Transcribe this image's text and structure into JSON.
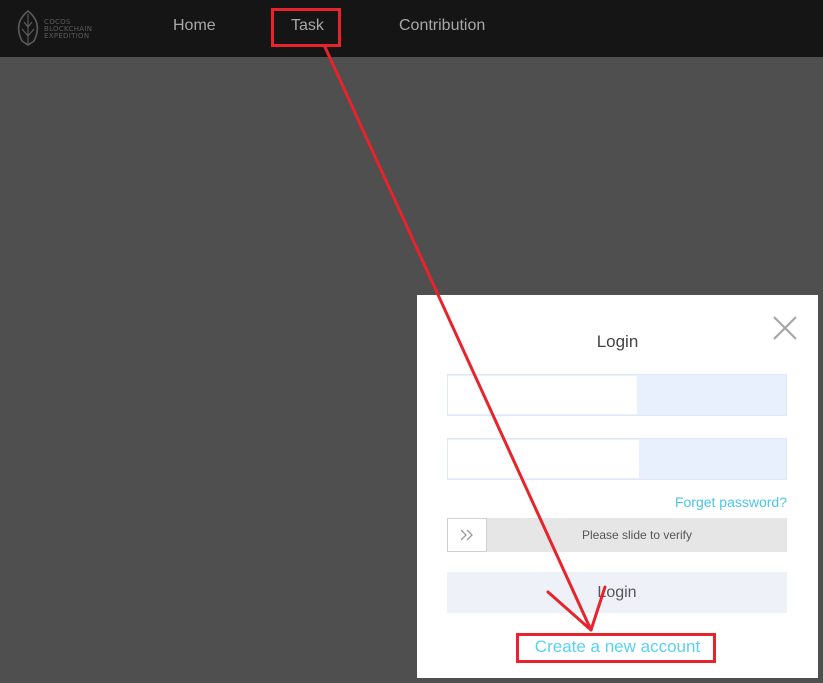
{
  "logo": {
    "lines": [
      "COCOS",
      "BLOCKCHAIN",
      "EXPEDITION"
    ],
    "icon": "leaf-logo-icon"
  },
  "nav": {
    "items": [
      {
        "label": "Home"
      },
      {
        "label": "Task"
      },
      {
        "label": "Contribution"
      }
    ]
  },
  "login_modal": {
    "title": "Login",
    "close_icon": "close-icon",
    "username": {
      "value": "",
      "placeholder": ""
    },
    "password": {
      "value": "",
      "placeholder": ""
    },
    "forget_password": "Forget password?",
    "slider": {
      "handle_icon": "double-chevron-right-icon",
      "text": "Please slide to verify"
    },
    "login_button": "Login",
    "create_account": "Create a new account"
  },
  "colors": {
    "topbar": "#151515",
    "overlay": "#4f4f4f",
    "link": "#4fc4e8",
    "annotation": "#e8232b"
  }
}
